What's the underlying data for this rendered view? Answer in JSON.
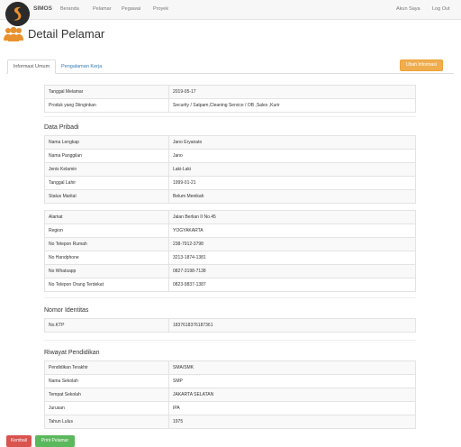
{
  "navbar": {
    "brand": "SIMOS",
    "items": [
      "Beranda",
      "Pelamar",
      "Pegawai",
      "Proyek"
    ],
    "account": "Akun Saya",
    "logout": "Log Out"
  },
  "header": {
    "title": "Detail Pelamar"
  },
  "tabs": {
    "active": "Informasi Umum",
    "other": "Pengalaman Kerja",
    "edit_button": "Ubah Informasi"
  },
  "application": [
    [
      "Tanggal Melamar",
      "2019-05-17"
    ],
    [
      "Produk yang Diinginkan",
      "Security / Satpam,Cleaning Service / OB ,Sales ,Kurir"
    ]
  ],
  "personal": {
    "title": "Data Pribadi",
    "rows": [
      [
        "Nama Lengkap",
        "Jano Eryanato"
      ],
      [
        "Nama Panggilan",
        "Jano"
      ],
      [
        "Jenis Kelamin",
        "Laki-Laki"
      ],
      [
        "Tanggal Lahir",
        "1999-01-21"
      ],
      [
        "Status Marital",
        "Belum Menikah"
      ]
    ]
  },
  "contact": [
    [
      "Alamat",
      "Jalan Berlian II No.45"
    ],
    [
      "Region",
      "YOGYAKARTA"
    ],
    [
      "No Telepon Rumah",
      "238-7912-3798"
    ],
    [
      "No Handphone",
      "3213-1874-1381"
    ],
    [
      "No Whatsapp",
      "0827-3198-7138"
    ],
    [
      "No Telepon Orang Terdekat",
      "0823-9837-1387"
    ]
  ],
  "identity": {
    "title": "Nomor Identitas",
    "rows": [
      [
        "No.KTP",
        "1837618376187361"
      ]
    ]
  },
  "education": {
    "title": "Riwayat Pendidikan",
    "rows": [
      [
        "Pendidikan Terakhir",
        "SMA/SMK"
      ],
      [
        "Nama Sekolah",
        "SMP"
      ],
      [
        "Tempat Sekolah",
        "JAKARTA SELATAN"
      ],
      [
        "Jurusan",
        "IPA"
      ],
      [
        "Tahun Lulus",
        "1975"
      ]
    ]
  },
  "footer": {
    "back": "Kembali",
    "print": "Print Pelamar"
  },
  "colors": {
    "warning": "#f0ad4e",
    "danger": "#d9534f",
    "success": "#5cb85c",
    "link": "#337ab7",
    "icon": "#e8912d"
  }
}
